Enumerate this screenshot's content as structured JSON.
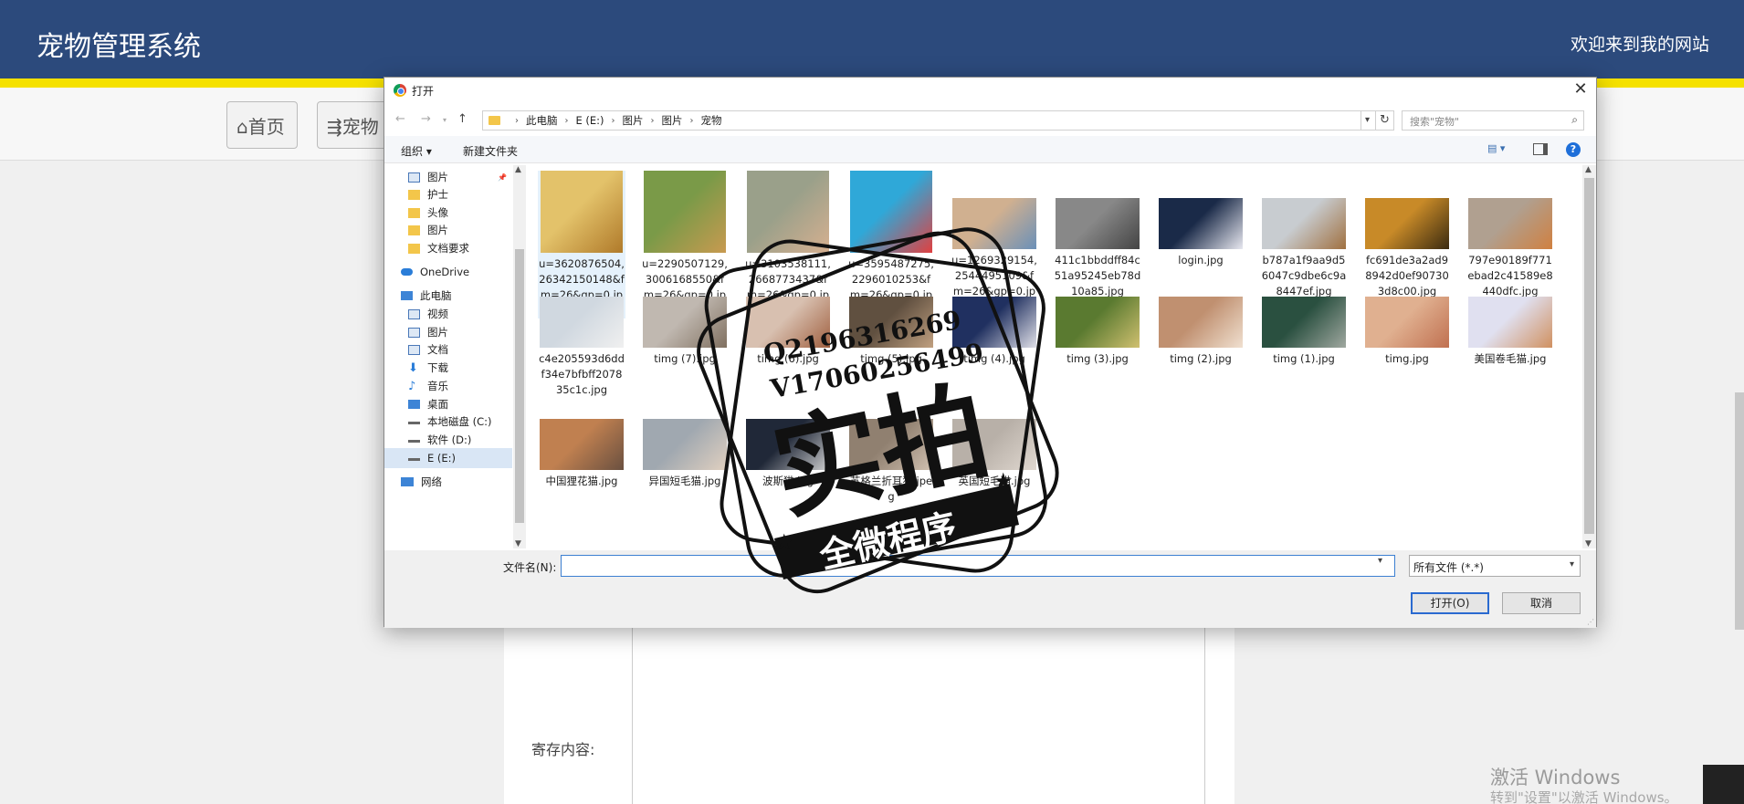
{
  "site": {
    "title": "宠物管理系统",
    "welcome": "欢迎来到我的网站",
    "nav": {
      "home": "⌂首页",
      "pet": "⇶宠物"
    },
    "content_label": "寄存内容:"
  },
  "windows_activation": {
    "title": "激活 Windows",
    "subtitle": "转到\"设置\"以激活 Windows。"
  },
  "dialog": {
    "title": "打开",
    "close": "✕",
    "address": {
      "crumbs": [
        "此电脑",
        "E (E:)",
        "图片",
        "图片",
        "宠物"
      ],
      "search_placeholder": "搜索\"宠物\""
    },
    "toolbar": {
      "organize": "组织 ▾",
      "new_folder": "新建文件夹",
      "help": "?"
    },
    "nav_pane": [
      {
        "label": "图片",
        "icon": "pictures-icon",
        "pinned": true
      },
      {
        "label": "护士",
        "icon": "folder-icon"
      },
      {
        "label": "头像",
        "icon": "folder-icon"
      },
      {
        "label": "图片",
        "icon": "folder-icon"
      },
      {
        "label": "文档要求",
        "icon": "folder-icon"
      },
      {
        "label": "OneDrive",
        "icon": "onedrive-icon"
      },
      {
        "label": "此电脑",
        "icon": "this-pc-icon"
      },
      {
        "label": "视频",
        "icon": "videos-icon"
      },
      {
        "label": "图片",
        "icon": "pictures-icon"
      },
      {
        "label": "文档",
        "icon": "documents-icon"
      },
      {
        "label": "下载",
        "icon": "download-icon"
      },
      {
        "label": "音乐",
        "icon": "music-icon"
      },
      {
        "label": "桌面",
        "icon": "desktop-icon"
      },
      {
        "label": "本地磁盘 (C:)",
        "icon": "drive-icon"
      },
      {
        "label": "软件 (D:)",
        "icon": "drive-icon"
      },
      {
        "label": "E (E:)",
        "icon": "drive-icon",
        "selected": true
      },
      {
        "label": "网络",
        "icon": "network-icon"
      }
    ],
    "files": [
      {
        "name": "u=3620876504,26342150148&fm=26&gp=0.jpg",
        "selected": true,
        "colors": [
          "#e3c26a",
          "#b07a2a"
        ]
      },
      {
        "name": "u=2290507129,3006168550&fm=26&gp=0.jpg",
        "colors": [
          "#7a9a48",
          "#c89a50"
        ]
      },
      {
        "name": "u=3103538111,2668773437&fm=26&gp=0.jpg",
        "colors": [
          "#9aa08a",
          "#d6b090"
        ]
      },
      {
        "name": "u=3595487275,2296010253&fm=26&gp=0.jpg",
        "colors": [
          "#2fa8d8",
          "#e04040"
        ]
      },
      {
        "name": "u=1269329154,2544495109&fm=26&gp=0.jpg",
        "colors": [
          "#d0b090",
          "#6a90b8"
        ]
      },
      {
        "name": "411c1bbddff84c51a95245eb78d10a85.jpg",
        "colors": [
          "#888888",
          "#444444"
        ]
      },
      {
        "name": "login.jpg",
        "colors": [
          "#1a2a48",
          "#e8e8f0"
        ]
      },
      {
        "name": "b787a1f9aa9d56047c9dbe6c9a8447ef.jpg",
        "colors": [
          "#c8ccd0",
          "#a07040"
        ]
      },
      {
        "name": "fc691de3a2ad98942d0ef907303d8c00.jpg",
        "colors": [
          "#c88a28",
          "#3a2a10"
        ]
      },
      {
        "name": "797e90189f771ebad2c41589e8440dfc.jpg",
        "colors": [
          "#b0a090",
          "#d08040"
        ]
      },
      {
        "name": "c4e205593d6ddf34e7bfbff207835c1c.jpg",
        "colors": [
          "#d0d8e0",
          "#f0f0f0"
        ]
      },
      {
        "name": "timg (7).jpg",
        "colors": [
          "#c0b8b0",
          "#807060"
        ]
      },
      {
        "name": "timg (6).jpg",
        "colors": [
          "#d8c0b0",
          "#a06040"
        ]
      },
      {
        "name": "timg (5).jpg",
        "colors": [
          "#605040",
          "#c0a080"
        ]
      },
      {
        "name": "timg (4).jpg",
        "colors": [
          "#203060",
          "#e0e0e8"
        ]
      },
      {
        "name": "timg (3).jpg",
        "colors": [
          "#5a7a30",
          "#d0c070"
        ]
      },
      {
        "name": "timg (2).jpg",
        "colors": [
          "#c09070",
          "#f0e0d0"
        ]
      },
      {
        "name": "timg (1).jpg",
        "colors": [
          "#2a5040",
          "#a0a8a0"
        ]
      },
      {
        "name": "timg.jpg",
        "colors": [
          "#e0b090",
          "#c07050"
        ]
      },
      {
        "name": "美国卷毛猫.jpg",
        "colors": [
          "#e0e0f0",
          "#d09060"
        ]
      },
      {
        "name": "中国狸花猫.jpg",
        "colors": [
          "#c08050",
          "#6a5040"
        ]
      },
      {
        "name": "异国短毛猫.jpg",
        "colors": [
          "#a0a8b0",
          "#e0d0c0"
        ]
      },
      {
        "name": "波斯猫.jpg",
        "colors": [
          "#202838",
          "#d0d0d0"
        ]
      },
      {
        "name": "苏格兰折耳猫.jpeg",
        "colors": [
          "#908070",
          "#d0c0b0"
        ]
      },
      {
        "name": "英国短毛猫.jpg",
        "colors": [
          "#b8b0a8",
          "#e0d8d0"
        ]
      }
    ],
    "filename_label": "文件名(N):",
    "filename_value": "",
    "file_type": "所有文件 (*.*)",
    "open_button": "打开(O)",
    "cancel_button": "取消"
  },
  "watermark": {
    "line1": "Q2196316269",
    "line2": "V17060256499",
    "main": "实拍",
    "banner": "全微程序"
  }
}
